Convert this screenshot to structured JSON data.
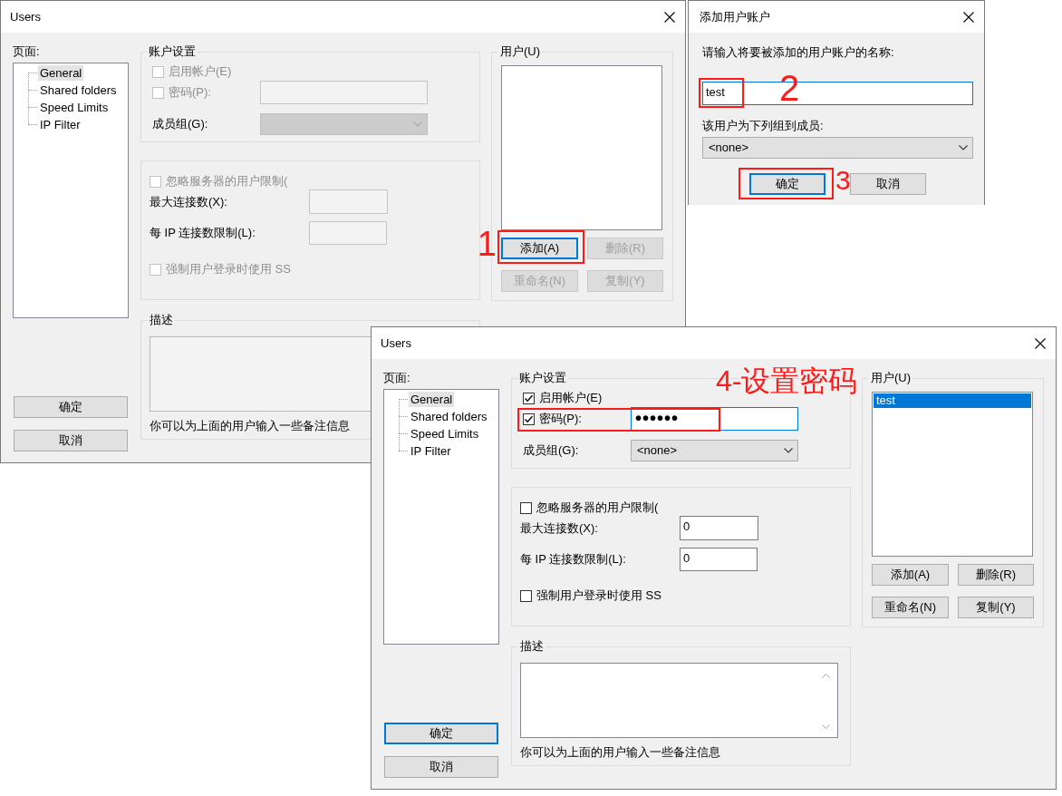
{
  "windows": [
    {
      "kind": "users",
      "title": "Users",
      "pages_label": "页面:",
      "pages": [
        {
          "label": "General",
          "selected": true
        },
        {
          "label": "Shared folders",
          "selected": false
        },
        {
          "label": "Speed Limits",
          "selected": false
        },
        {
          "label": "IP Filter",
          "selected": false
        }
      ],
      "account_settings": {
        "title": "账户设置",
        "enable_account": {
          "label": "启用帐户(E)",
          "checked": false,
          "disabled": true
        },
        "password": {
          "label": "密码(P):",
          "checked": false,
          "disabled": true,
          "focused": false
        },
        "group": {
          "label": "成员组(G):",
          "disabled": true
        }
      },
      "limits": {
        "ignore_server_limits": {
          "label": "忽略服务器的用户限制(",
          "checked": false,
          "disabled": true
        },
        "max_connections": {
          "label": "最大连接数(X):",
          "disabled": true
        },
        "per_ip_limit": {
          "label": "每 IP 连接数限制(L):",
          "disabled": true
        },
        "force_ssl": {
          "label": "强制用户登录时使用 SS",
          "checked": false,
          "disabled": true
        }
      },
      "description": {
        "title": "描述",
        "disabled": true,
        "hint": "你可以为上面的用户输入一些备注信息"
      },
      "users": {
        "title": "用户(U)",
        "buttons": [
          {
            "label": "添加(A)",
            "disabled": false,
            "focused": true,
            "callout": "1"
          },
          {
            "label": "删除(R)",
            "disabled": true,
            "focused": false
          },
          {
            "label": "重命名(N)",
            "disabled": true,
            "focused": false
          },
          {
            "label": "复制(Y)",
            "disabled": true,
            "focused": false
          }
        ]
      },
      "buttons": [
        {
          "label": "确定",
          "focused": false
        },
        {
          "label": "取消",
          "focused": false
        }
      ]
    },
    {
      "kind": "add_user",
      "title": "添加用户账户",
      "name_prompt": "请输入将要被添加的用户账户的名称:",
      "name_field": {
        "value": "test",
        "focused": true,
        "callout": "2"
      },
      "group_prompt": "该用户为下列组到成员:",
      "group_field": {
        "value": "<none>"
      },
      "buttons": [
        {
          "label": "确定",
          "focused": true,
          "callout": "3"
        },
        {
          "label": "取消",
          "focused": false
        }
      ]
    },
    {
      "kind": "users",
      "title": "Users",
      "pages_label": "页面:",
      "pages": [
        {
          "label": "General",
          "selected": true
        },
        {
          "label": "Shared folders",
          "selected": false
        },
        {
          "label": "Speed Limits",
          "selected": false
        },
        {
          "label": "IP Filter",
          "selected": false
        }
      ],
      "account_settings": {
        "title": "账户设置",
        "enable_account": {
          "label": "启用帐户(E)",
          "checked": true,
          "disabled": false
        },
        "password": {
          "label": "密码(P):",
          "checked": true,
          "disabled": false,
          "focused": true,
          "value": "••••••",
          "callout": "4-设置密码"
        },
        "group": {
          "label": "成员组(G):",
          "disabled": false,
          "value": "<none>"
        }
      },
      "limits": {
        "ignore_server_limits": {
          "label": "忽略服务器的用户限制(",
          "checked": false,
          "disabled": false
        },
        "max_connections": {
          "label": "最大连接数(X):",
          "disabled": false,
          "value": "0"
        },
        "per_ip_limit": {
          "label": "每 IP 连接数限制(L):",
          "disabled": false,
          "value": "0"
        },
        "force_ssl": {
          "label": "强制用户登录时使用 SS",
          "checked": false,
          "disabled": false
        }
      },
      "description": {
        "title": "描述",
        "disabled": false,
        "hint": "你可以为上面的用户输入一些备注信息"
      },
      "users": {
        "title": "用户(U)",
        "items": [
          {
            "label": "test",
            "selected": true
          }
        ],
        "buttons": [
          {
            "label": "添加(A)",
            "disabled": false,
            "focused": false
          },
          {
            "label": "删除(R)",
            "disabled": false,
            "focused": false
          },
          {
            "label": "重命名(N)",
            "disabled": false,
            "focused": false
          },
          {
            "label": "复制(Y)",
            "disabled": false,
            "focused": false
          }
        ]
      },
      "buttons": [
        {
          "label": "确定",
          "focused": true
        },
        {
          "label": "取消",
          "focused": false
        }
      ]
    }
  ]
}
